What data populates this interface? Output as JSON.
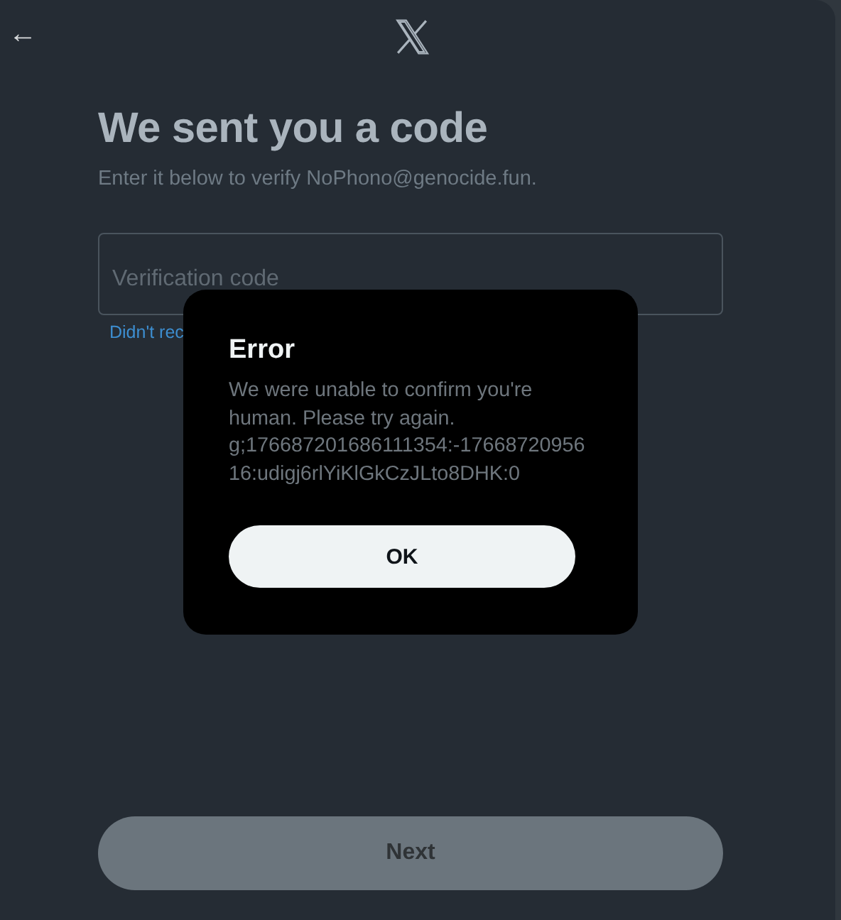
{
  "header": {
    "back_label": "←"
  },
  "heading": "We sent you a code",
  "subtitle": "Enter it below to verify NoPhono@genocide.fun.",
  "code_field": {
    "placeholder": "Verification code"
  },
  "resend_link": "Didn't rec",
  "dialog": {
    "title": "Error",
    "message": "We were unable to confirm you're human. Please try again. g;176687201686111354:-1766872095616:udigj6rlYiKlGkCzJLto8DHK:0",
    "button": "OK"
  },
  "next_button": {
    "label": "Next",
    "disabled": true
  }
}
